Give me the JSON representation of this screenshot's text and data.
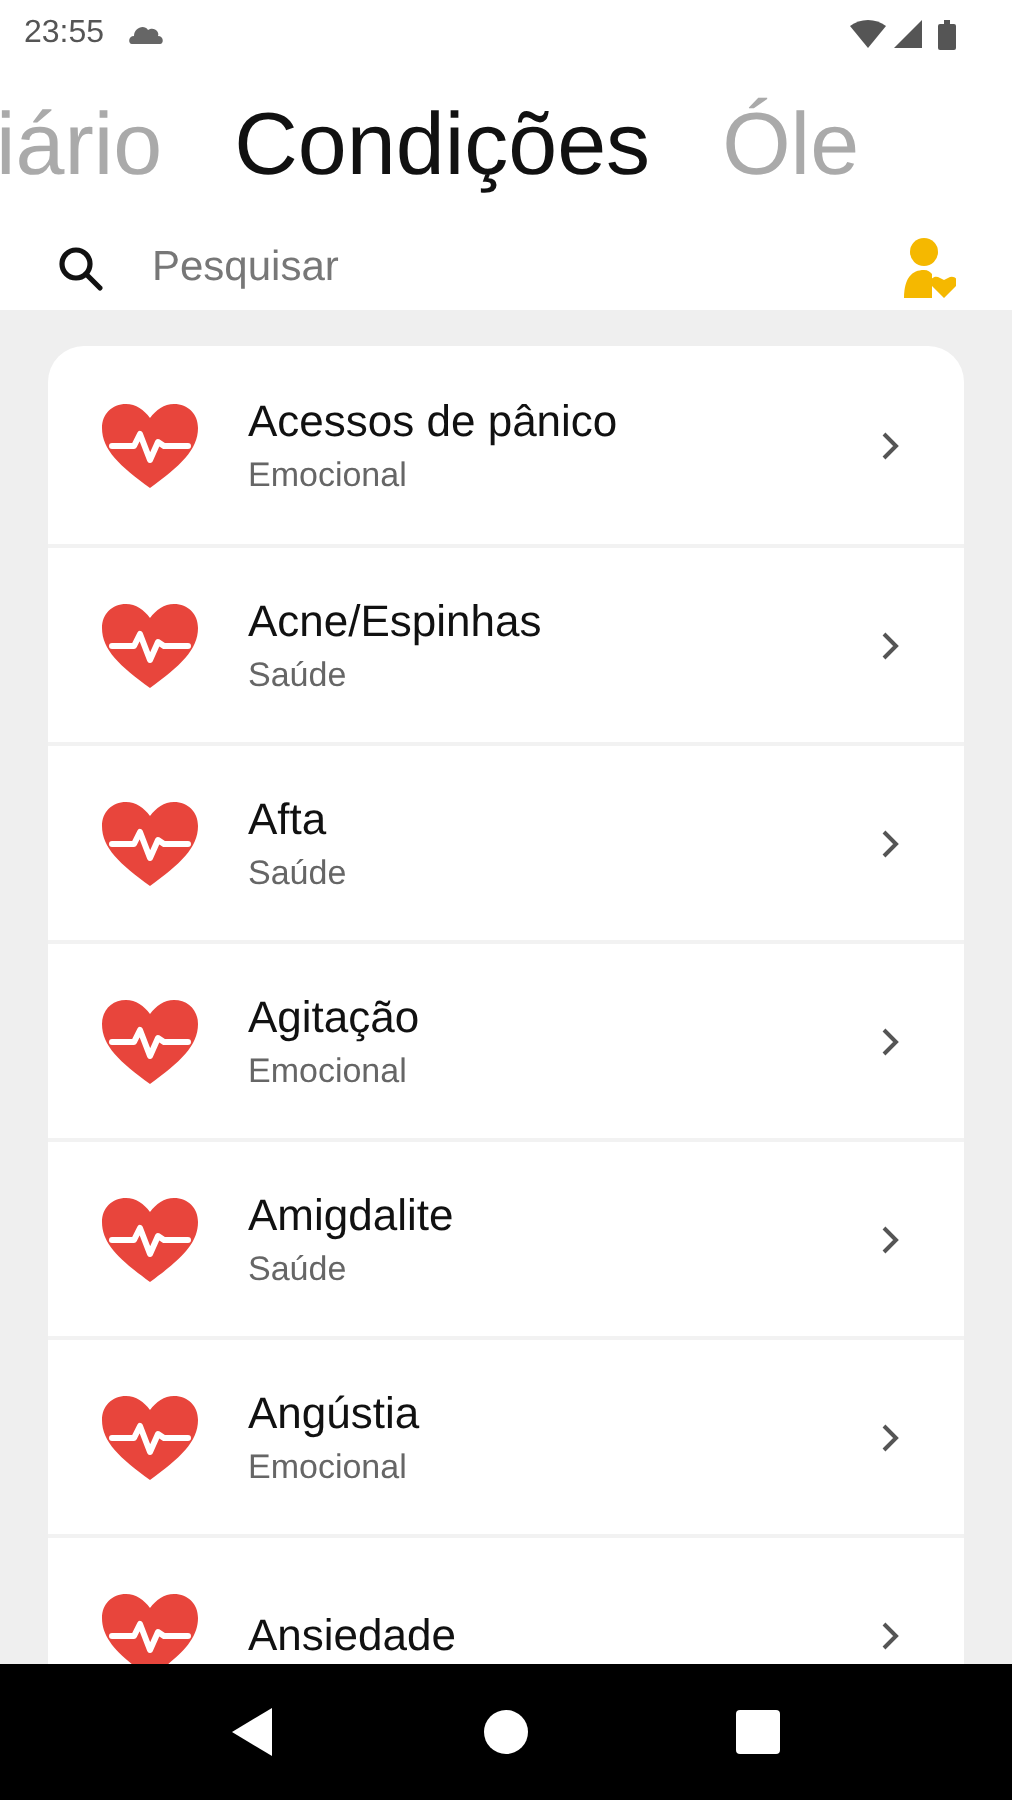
{
  "status_bar": {
    "time": "23:55"
  },
  "tabs": [
    {
      "label": "iário",
      "selected": false
    },
    {
      "label": "Condições",
      "selected": true
    },
    {
      "label": "Óle",
      "selected": false
    }
  ],
  "search": {
    "placeholder": "Pesquisar"
  },
  "conditions": [
    {
      "name": "Acessos de pânico",
      "category": "Emocional"
    },
    {
      "name": "Acne/Espinhas",
      "category": "Saúde"
    },
    {
      "name": "Afta",
      "category": "Saúde"
    },
    {
      "name": "Agitação",
      "category": "Emocional"
    },
    {
      "name": "Amigdalite",
      "category": "Saúde"
    },
    {
      "name": "Angústia",
      "category": "Emocional"
    },
    {
      "name": "Ansiedade"
    }
  ]
}
